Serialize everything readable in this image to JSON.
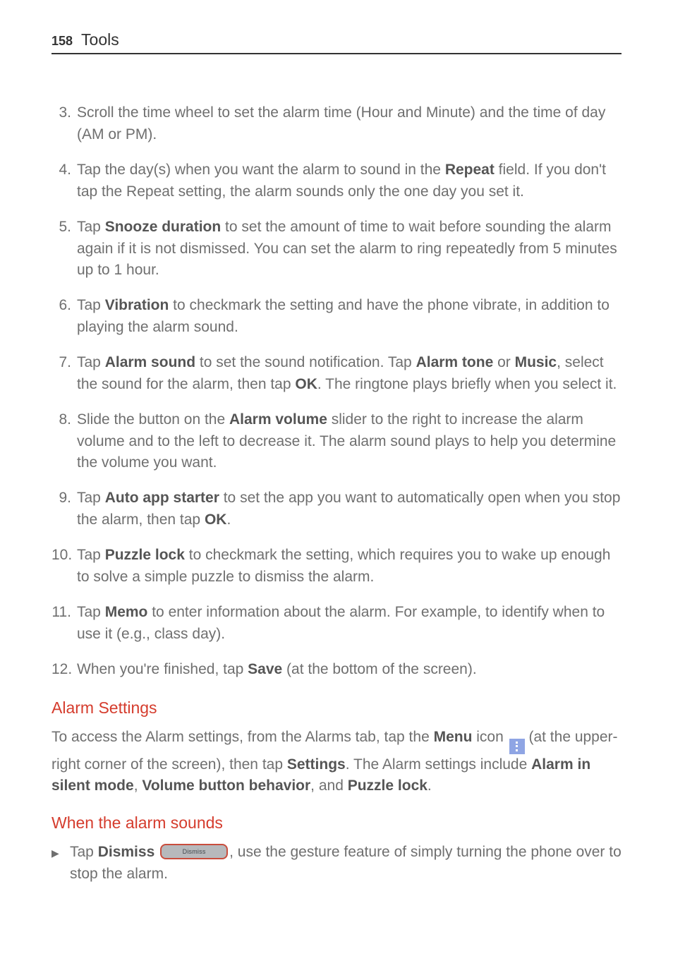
{
  "page_number": "158",
  "running_title": "Tools",
  "steps": [
    {
      "n": "3.",
      "parts": [
        "Scroll the time wheel to set the alarm time (Hour and Minute) and the time of day (AM or PM)."
      ]
    },
    {
      "n": "4.",
      "parts": [
        "Tap the day(s) when you want the alarm to sound in the ",
        {
          "b": "Repeat"
        },
        " field. If you don't tap the Repeat setting, the alarm sounds only the one day you set it."
      ]
    },
    {
      "n": "5.",
      "parts": [
        "Tap ",
        {
          "b": "Snooze duration"
        },
        " to set the amount of time to wait before sounding the alarm again if it is not dismissed. You can set the alarm to ring repeatedly from 5 minutes up to 1 hour."
      ]
    },
    {
      "n": "6.",
      "parts": [
        "Tap ",
        {
          "b": "Vibration"
        },
        " to checkmark the setting and have the phone vibrate, in addition to playing the alarm sound."
      ]
    },
    {
      "n": "7.",
      "parts": [
        "Tap ",
        {
          "b": "Alarm sound"
        },
        " to set the sound notification. Tap ",
        {
          "b": "Alarm tone"
        },
        " or ",
        {
          "b": "Music"
        },
        ", select the sound for the alarm, then tap ",
        {
          "b": "OK"
        },
        ". The ringtone plays briefly when you select it."
      ]
    },
    {
      "n": "8.",
      "parts": [
        "Slide the button on the ",
        {
          "b": "Alarm volume"
        },
        " slider to the right to increase the alarm volume and to the left to decrease it. The alarm sound plays to help you determine the volume you want."
      ]
    },
    {
      "n": "9.",
      "parts": [
        "Tap ",
        {
          "b": "Auto app starter"
        },
        " to set the app you want to automatically open when you stop the alarm, then tap ",
        {
          "b": "OK"
        },
        "."
      ]
    },
    {
      "n": "10.",
      "parts": [
        "Tap ",
        {
          "b": "Puzzle lock"
        },
        " to checkmark the setting, which requires you to wake up enough to solve a simple puzzle to dismiss the alarm."
      ]
    },
    {
      "n": "11.",
      "parts": [
        "Tap ",
        {
          "b": "Memo"
        },
        " to enter information about the alarm. For example, to identify when to use it (e.g., class day)."
      ]
    },
    {
      "n": "12.",
      "parts": [
        "When you're finished, tap ",
        {
          "b": "Save"
        },
        " (at the bottom of the screen)."
      ]
    }
  ],
  "section_alarm_settings": {
    "heading": "Alarm Settings",
    "paragraph": [
      "To access the Alarm settings, from the Alarms tab, tap the ",
      {
        "b": "Menu"
      },
      " icon ",
      {
        "icon": "menu"
      },
      " (at the upper-right corner of the screen), then tap ",
      {
        "b": "Settings"
      },
      ". The Alarm settings include ",
      {
        "b": "Alarm in silent mode"
      },
      ", ",
      {
        "b": "Volume button behavior"
      },
      ", and ",
      {
        "b": "Puzzle lock"
      },
      "."
    ]
  },
  "section_when_sounds": {
    "heading": "When the alarm sounds",
    "bullet": [
      "Tap ",
      {
        "b": "Dismiss"
      },
      " ",
      {
        "icon": "dismiss"
      },
      ", use the gesture feature of simply turning the phone over to stop the alarm."
    ]
  },
  "icons": {
    "dismiss_label": "Dismiss"
  }
}
